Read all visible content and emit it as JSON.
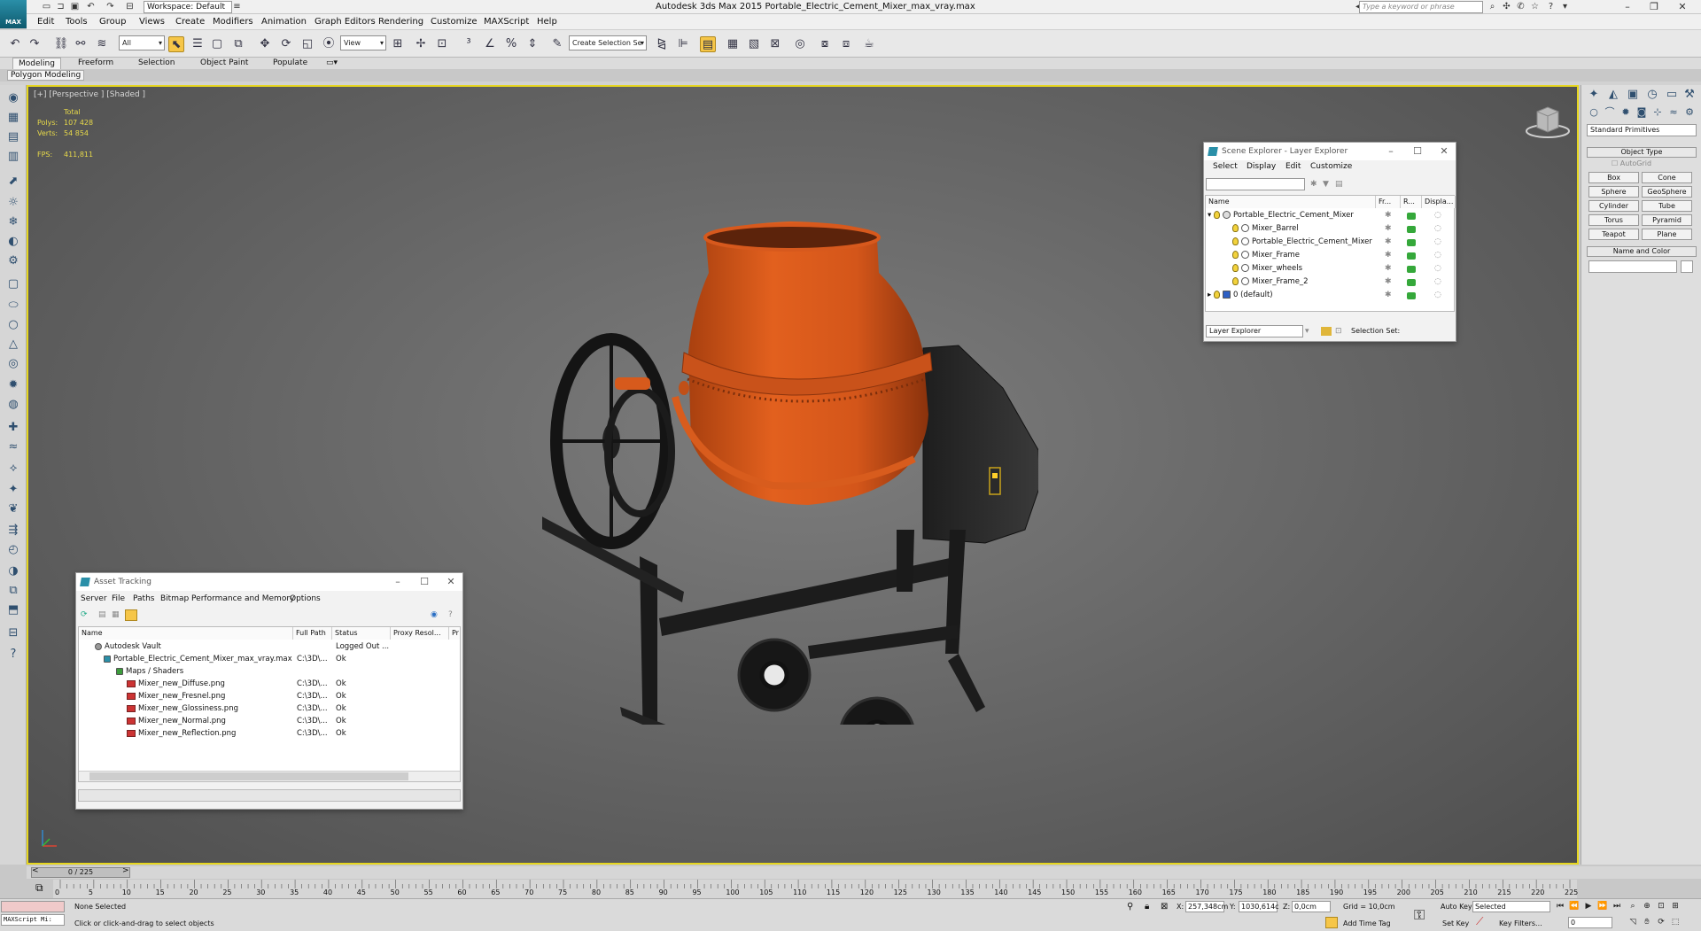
{
  "titlebar": {
    "title": "Autodesk 3ds Max  2015    Portable_Electric_Cement_Mixer_max_vray.max",
    "workspace": "Workspace: Default",
    "search_placeholder": "Type a keyword or phrase",
    "logo_text": "MAX"
  },
  "menubar": [
    "Edit",
    "Tools",
    "Group",
    "Views",
    "Create",
    "Modifiers",
    "Animation",
    "Graph Editors",
    "Rendering",
    "Customize",
    "MAXScript",
    "Help"
  ],
  "toolbar": {
    "selection_filter": "All",
    "ref_coord": "View",
    "named_selection": "Create Selection Se"
  },
  "ribbon": {
    "tabs": [
      "Modeling",
      "Freeform",
      "Selection",
      "Object Paint",
      "Populate"
    ],
    "active": "Modeling",
    "subpanel": "Polygon Modeling"
  },
  "viewport": {
    "label": "[+] [Perspective ] [Shaded ]",
    "stats_header": "Total",
    "polys_label": "Polys:",
    "polys_value": "107 428",
    "verts_label": "Verts:",
    "verts_value": "54 854",
    "fps_label": "FPS:",
    "fps_value": "411,811"
  },
  "scene_explorer": {
    "title": "Scene Explorer - Layer Explorer",
    "menu": [
      "Select",
      "Display",
      "Edit",
      "Customize"
    ],
    "columns": [
      "Name",
      "Fr...",
      "R...",
      "Displa..."
    ],
    "rows": [
      {
        "name": "Portable_Electric_Cement_Mixer",
        "level": 0
      },
      {
        "name": "Mixer_Barrel",
        "level": 1
      },
      {
        "name": "Portable_Electric_Cement_Mixer",
        "level": 1
      },
      {
        "name": "Mixer_Frame",
        "level": 1
      },
      {
        "name": "Mixer_wheels",
        "level": 1
      },
      {
        "name": "Mixer_Frame_2",
        "level": 1
      },
      {
        "name": "0 (default)",
        "level": 0
      }
    ],
    "footer_combo": "Layer Explorer",
    "selection_set_label": "Selection Set:"
  },
  "asset_tracking": {
    "title": "Asset Tracking",
    "menu": [
      "Server",
      "File",
      "Paths",
      "Bitmap Performance and Memory",
      "Options"
    ],
    "columns": [
      "Name",
      "Full Path",
      "Status",
      "Proxy Resol...",
      "Pr"
    ],
    "rows": [
      {
        "name": "Autodesk Vault",
        "path": "",
        "status": "Logged Out ...",
        "level": 0
      },
      {
        "name": "Portable_Electric_Cement_Mixer_max_vray.max",
        "path": "C:\\3D\\...",
        "status": "Ok",
        "level": 1
      },
      {
        "name": "Maps / Shaders",
        "path": "",
        "status": "",
        "level": 2
      },
      {
        "name": "Mixer_new_Diffuse.png",
        "path": "C:\\3D\\...",
        "status": "Ok",
        "level": 3
      },
      {
        "name": "Mixer_new_Fresnel.png",
        "path": "C:\\3D\\...",
        "status": "Ok",
        "level": 3
      },
      {
        "name": "Mixer_new_Glossiness.png",
        "path": "C:\\3D\\...",
        "status": "Ok",
        "level": 3
      },
      {
        "name": "Mixer_new_Normal.png",
        "path": "C:\\3D\\...",
        "status": "Ok",
        "level": 3
      },
      {
        "name": "Mixer_new_Reflection.png",
        "path": "C:\\3D\\...",
        "status": "Ok",
        "level": 3
      }
    ]
  },
  "command_panel": {
    "category": "Standard Primitives",
    "object_type_header": "Object Type",
    "autogrid": "AutoGrid",
    "buttons": [
      "Box",
      "Cone",
      "Sphere",
      "GeoSphere",
      "Cylinder",
      "Tube",
      "Torus",
      "Pyramid",
      "Teapot",
      "Plane"
    ],
    "name_color_header": "Name and Color"
  },
  "timeline": {
    "frame_label": "0 / 225",
    "ticks": [
      "0",
      "5",
      "10",
      "15",
      "20",
      "25",
      "30",
      "35",
      "40",
      "45",
      "50",
      "55",
      "60",
      "65",
      "70",
      "75",
      "80",
      "85",
      "90",
      "95",
      "100",
      "105",
      "110",
      "115",
      "120",
      "125",
      "130",
      "135",
      "140",
      "145",
      "150",
      "155",
      "160",
      "165",
      "170",
      "175",
      "180",
      "185",
      "190",
      "195",
      "200",
      "205",
      "210",
      "215",
      "220",
      "225"
    ]
  },
  "statusbar": {
    "maxscript": "MAXScript Mi:",
    "selection_status": "None Selected",
    "prompt": "Click or click-and-drag to select objects",
    "x_label": "X:",
    "x_value": "257,348cm",
    "y_label": "Y:",
    "y_value": "1030,614c",
    "z_label": "Z:",
    "z_value": "0,0cm",
    "grid": "Grid = 10,0cm",
    "add_time_tag": "Add Time Tag",
    "auto_key": "Auto Key",
    "set_key": "Set Key",
    "key_mode": "Selected",
    "key_filters": "Key Filters...",
    "current_frame": "0"
  }
}
